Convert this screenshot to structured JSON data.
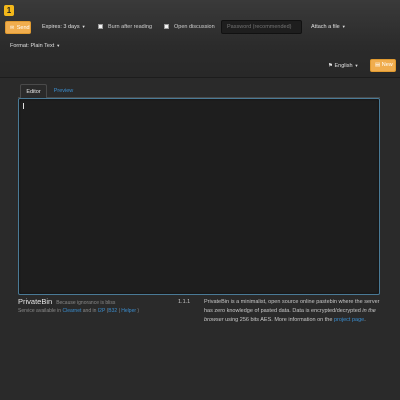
{
  "navbar": {
    "logo_glyph": "1",
    "send_label": "Send",
    "send_icon": "send-icon",
    "expires": "Expires: 3 days",
    "burn_label": "Burn after reading",
    "discussion_label": "Open discussion",
    "password_placeholder": "Password (recommended)",
    "attach_label": "Attach a file",
    "format_label": "Format: Plain Text",
    "language_label": "English",
    "new_label": "New"
  },
  "tabs": {
    "editor": "Editor",
    "preview": "Preview"
  },
  "editor": {
    "value": ""
  },
  "footer": {
    "name": "PrivateBin",
    "slogan": "Because ignorance is bliss",
    "avail_prefix": "Service available in",
    "clearnet": "Clearnet",
    "and_in": "and in",
    "i2p": "I2P",
    "sep1": "(",
    "b32": "B32",
    "sep2": "|",
    "helper": "Helper",
    "sep3": ")",
    "version": "1.1.1",
    "about_1": "PrivateBin is a minimalist, open source online pastebin where the server has zero knowledge of pasted data. Data is encrypted/decrypted",
    "about_in": "in the browser",
    "about_2": "using 256 bits AES. More information on the",
    "project_page": "project page",
    "about_end": "."
  },
  "colors": {
    "accent": "#f0ad4e",
    "link": "#3a8ed0",
    "background": "#2a2a2a"
  }
}
